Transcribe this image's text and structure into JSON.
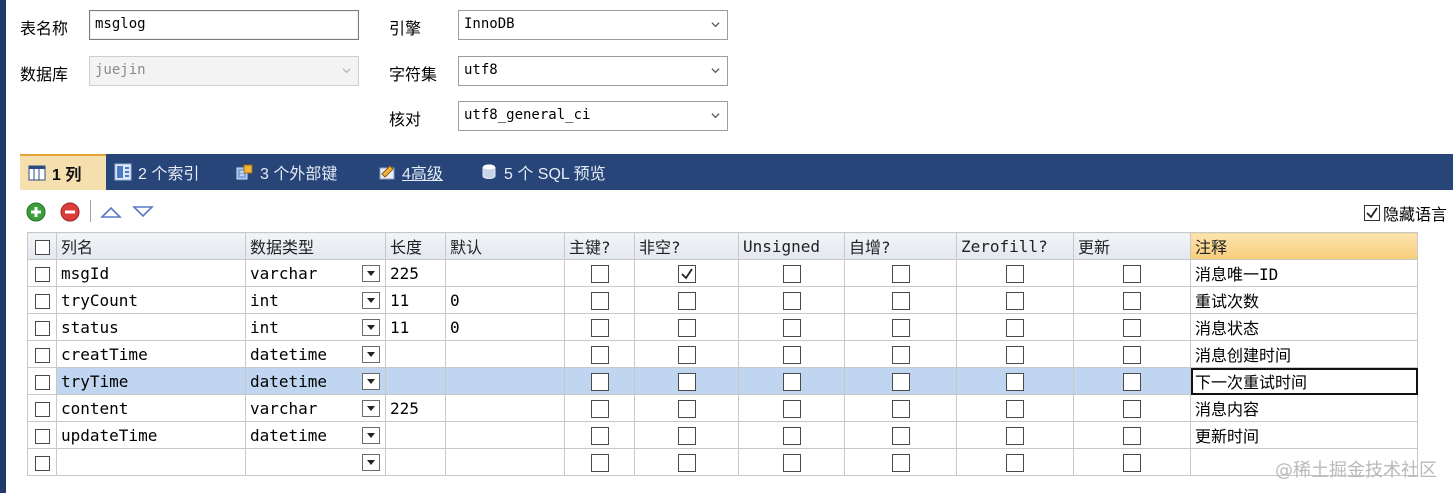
{
  "form": {
    "table_name_label": "表名称",
    "table_name_value": "msglog",
    "database_label": "数据库",
    "database_value": "juejin",
    "engine_label": "引擎",
    "engine_value": "InnoDB",
    "charset_label": "字符集",
    "charset_value": "utf8",
    "collation_label": "核对",
    "collation_value": "utf8_general_ci"
  },
  "tabs": [
    {
      "label": "1 列",
      "icon": "columns-icon",
      "active": true
    },
    {
      "label": "2 个索引",
      "icon": "index-icon",
      "active": false
    },
    {
      "label": "3 个外部键",
      "icon": "foreign-key-icon",
      "active": false
    },
    {
      "label": "4高级",
      "icon": "advanced-icon",
      "active": false
    },
    {
      "label": "5 个 SQL 预览",
      "icon": "sql-preview-icon",
      "active": false
    }
  ],
  "toolbar": {
    "hide_lang_label": "隐藏语言",
    "hide_lang_checked": true
  },
  "columns": {
    "name": "列名",
    "type": "数据类型",
    "length": "长度",
    "default": "默认",
    "pk": "主键?",
    "not_null": "非空?",
    "unsigned": "Unsigned",
    "auto_inc": "自增?",
    "zerofill": "Zerofill?",
    "update": "更新",
    "comment": "注释"
  },
  "rows": [
    {
      "name": "msgId",
      "type": "varchar",
      "length": "225",
      "default": "",
      "not_null": true,
      "comment": "消息唯一ID"
    },
    {
      "name": "tryCount",
      "type": "int",
      "length": "11",
      "default": "0",
      "not_null": false,
      "comment": "重试次数"
    },
    {
      "name": "status",
      "type": "int",
      "length": "11",
      "default": "0",
      "not_null": false,
      "comment": "消息状态"
    },
    {
      "name": "creatTime",
      "type": "datetime",
      "length": "",
      "default": "",
      "not_null": false,
      "comment": "消息创建时间"
    },
    {
      "name": "tryTime",
      "type": "datetime",
      "length": "",
      "default": "",
      "not_null": false,
      "comment": "下一次重试时间",
      "selected": true
    },
    {
      "name": "content",
      "type": "varchar",
      "length": "225",
      "default": "",
      "not_null": false,
      "comment": "消息内容"
    },
    {
      "name": "updateTime",
      "type": "datetime",
      "length": "",
      "default": "",
      "not_null": false,
      "comment": "更新时间"
    },
    {
      "name": "",
      "type": "",
      "length": "",
      "default": "",
      "not_null": false,
      "comment": ""
    }
  ],
  "watermark": "@稀土掘金技术社区",
  "colors": {
    "tab_bar": "#274578",
    "tab_active": "#f5dfae",
    "selected_row": "#bfd5f0",
    "comment_header": "#f8cd7a"
  }
}
